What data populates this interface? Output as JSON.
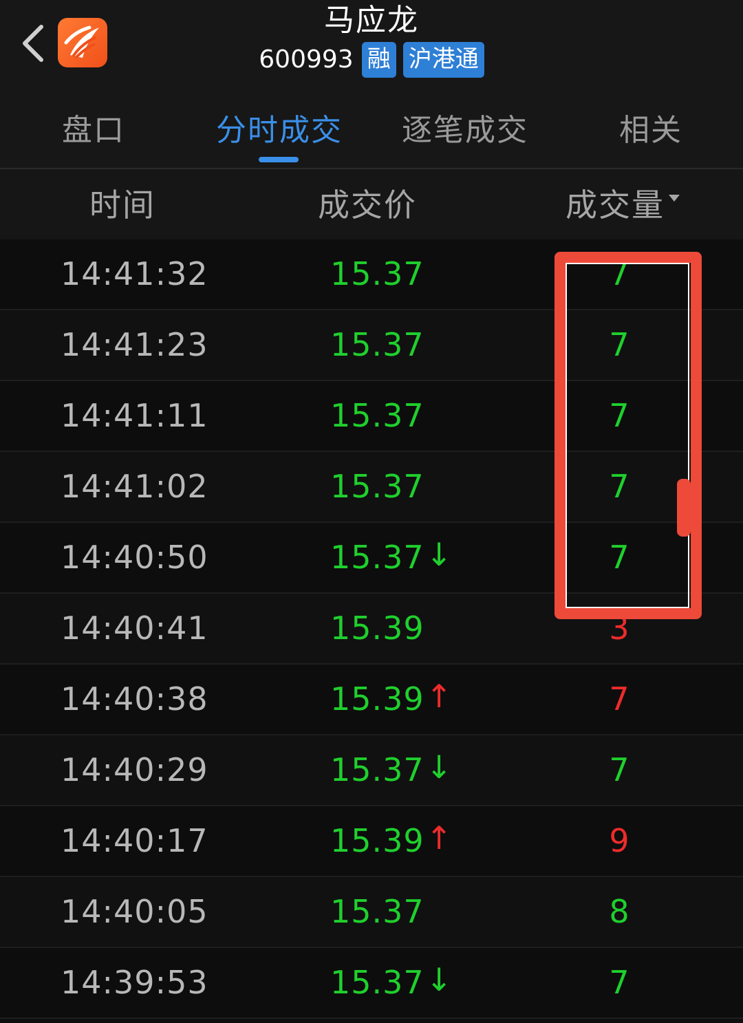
{
  "header": {
    "stock_name": "马应龙",
    "stock_code": "600993",
    "badges": [
      "融",
      "沪港通"
    ]
  },
  "icons": {
    "back": "chevron-left-icon",
    "logo": "app-logo-icon"
  },
  "tabs": [
    {
      "label": "盘口",
      "active": false
    },
    {
      "label": "分时成交",
      "active": true
    },
    {
      "label": "逐笔成交",
      "active": false
    },
    {
      "label": "相关",
      "active": false
    }
  ],
  "table": {
    "columns": {
      "time": "时间",
      "price": "成交价",
      "volume": "成交量"
    },
    "rows": [
      {
        "time": "14:41:32",
        "price": "15.37",
        "arrow": "",
        "volume": "7",
        "volume_color": "green"
      },
      {
        "time": "14:41:23",
        "price": "15.37",
        "arrow": "",
        "volume": "7",
        "volume_color": "green"
      },
      {
        "time": "14:41:11",
        "price": "15.37",
        "arrow": "",
        "volume": "7",
        "volume_color": "green"
      },
      {
        "time": "14:41:02",
        "price": "15.37",
        "arrow": "",
        "volume": "7",
        "volume_color": "green"
      },
      {
        "time": "14:40:50",
        "price": "15.37",
        "arrow": "↓",
        "volume": "7",
        "volume_color": "green"
      },
      {
        "time": "14:40:41",
        "price": "15.39",
        "arrow": "",
        "volume": "3",
        "volume_color": "red"
      },
      {
        "time": "14:40:38",
        "price": "15.39",
        "arrow": "↑",
        "volume": "7",
        "volume_color": "red"
      },
      {
        "time": "14:40:29",
        "price": "15.37",
        "arrow": "↓",
        "volume": "7",
        "volume_color": "green"
      },
      {
        "time": "14:40:17",
        "price": "15.39",
        "arrow": "↑",
        "volume": "9",
        "volume_color": "red"
      },
      {
        "time": "14:40:05",
        "price": "15.37",
        "arrow": "",
        "volume": "8",
        "volume_color": "green"
      },
      {
        "time": "14:39:53",
        "price": "15.37",
        "arrow": "↓",
        "volume": "7",
        "volume_color": "green"
      }
    ]
  },
  "colors": {
    "up": "#ee2b2b",
    "down": "#1fd02d",
    "accent": "#3a8fe8",
    "badge": "#2e7fd6",
    "highlight": "#ee4a3a"
  }
}
